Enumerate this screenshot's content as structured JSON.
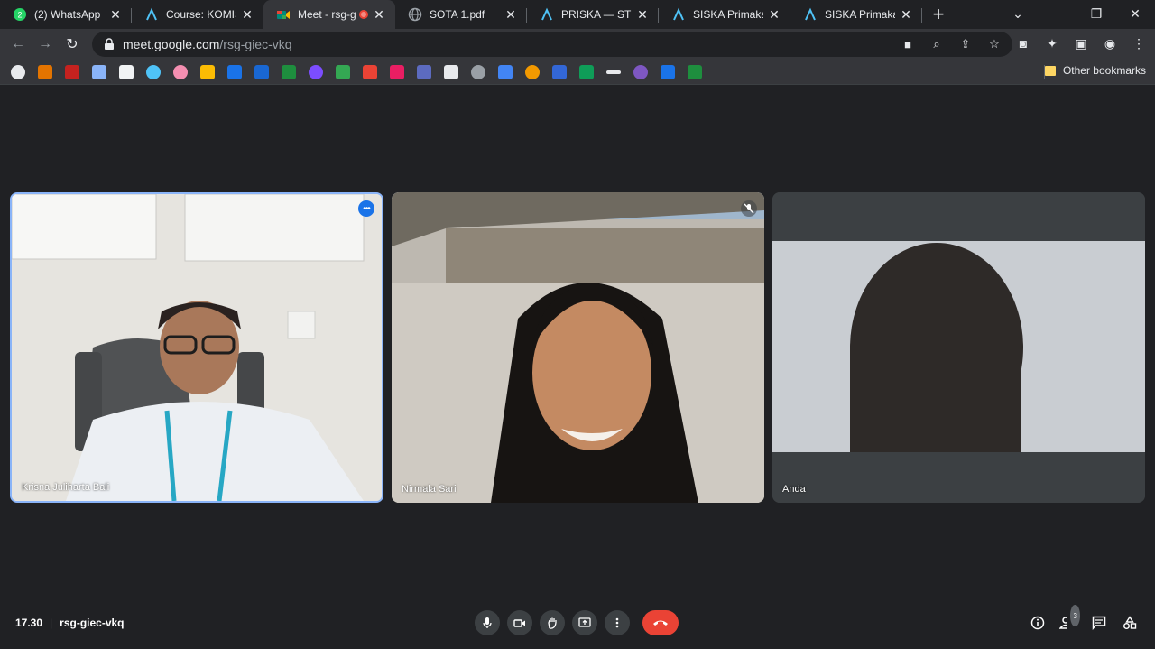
{
  "tabs": [
    {
      "title": "(2) WhatsApp",
      "icon": "whatsapp-icon"
    },
    {
      "title": "Course: KOMISI P",
      "icon": "moodle-icon"
    },
    {
      "title": "Meet - rsg-g",
      "icon": "meet-icon",
      "active": true
    },
    {
      "title": "SOTA 1.pdf",
      "icon": "globe-icon"
    },
    {
      "title": "PRISKA — STMIK",
      "icon": "moodle-icon"
    },
    {
      "title": "SISKA Primakara",
      "icon": "moodle-icon"
    },
    {
      "title": "SISKA Primakara",
      "icon": "moodle-icon"
    }
  ],
  "address": {
    "host": "meet.google.com",
    "path": "/rsg-giec-vkq"
  },
  "bookmarks": {
    "other_label": "Other bookmarks"
  },
  "participants": [
    {
      "name": "Krisna Juliharta Bali",
      "speaking": true
    },
    {
      "name": "Nirmala Sari",
      "muted": true
    },
    {
      "name": "Anda"
    }
  ],
  "meeting": {
    "time": "17.30",
    "code": "rsg-giec-vkq",
    "people_count": "3"
  },
  "colors": {
    "accent": "#8ab4f8",
    "end_call": "#ea4335",
    "background": "#202124"
  }
}
